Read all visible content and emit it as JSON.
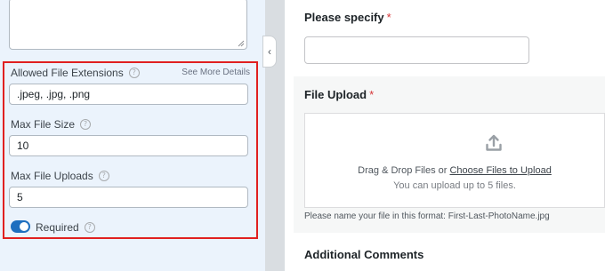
{
  "settings": {
    "allowed_ext": {
      "label": "Allowed File Extensions",
      "help": "?",
      "see_more": "See More Details",
      "value": ".jpeg, .jpg, .png"
    },
    "max_size": {
      "label": "Max File Size",
      "help": "?",
      "value": "10"
    },
    "max_uploads": {
      "label": "Max File Uploads",
      "help": "?",
      "value": "5"
    },
    "required": {
      "label": "Required",
      "help": "?",
      "enabled": true
    }
  },
  "collapse_glyph": "‹",
  "form": {
    "specify": {
      "label": "Please specify",
      "required_mark": "*"
    },
    "upload": {
      "label": "File Upload",
      "required_mark": "*",
      "drop_text": "Drag & Drop Files or ",
      "choose_link": "Choose Files to Upload",
      "limit_text": "You can upload up to 5 files.",
      "format_note": "Please name your file in this format: First-Last-PhotoName.jpg"
    },
    "comments": {
      "label": "Additional Comments"
    }
  },
  "icons": {
    "upload": "upload-icon",
    "help": "question-circle-icon",
    "collapse": "chevron-left-icon"
  },
  "colors": {
    "panel_bg": "#ebf3fc",
    "highlight": "#e02020",
    "toggle_on": "#1e6fbf",
    "required": "#d63638"
  }
}
